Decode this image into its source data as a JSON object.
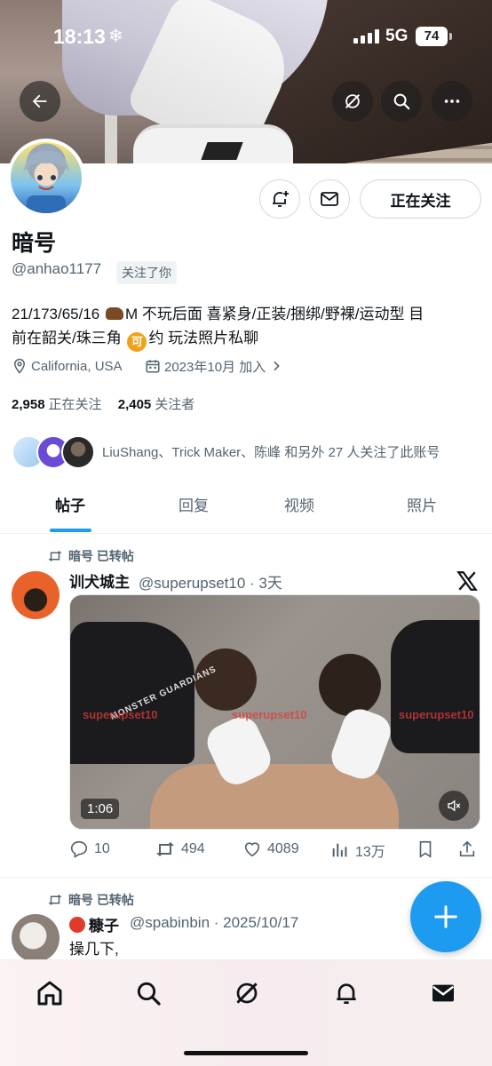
{
  "status_bar": {
    "time": "18:13",
    "network": "5G",
    "battery": "74"
  },
  "header": {
    "back_label": "back",
    "grok_label": "grok",
    "search_label": "search",
    "more_label": "more"
  },
  "profile": {
    "name": "暗号",
    "handle": "@anhao1177",
    "follows_you": "关注了你",
    "bio_line1_a": "21/173/65/16 ",
    "bio_line1_b": "M 不玩后面 喜紧身/正装/捆绑/野裸/运动型 目",
    "bio_line2_a": "前在韶关/珠三角 ",
    "bio_ke": "可",
    "bio_line2_b": "约 玩法照片私聊",
    "location": "California, USA",
    "joined": "2023年10月 加入",
    "following_count": "2,958",
    "following_label": "正在关注",
    "followers_count": "2,405",
    "followers_label": "关注者",
    "follow_button": "正在关注",
    "mutuals_text": "LiuShang、Trick Maker、陈峰 和另外 27 人关注了此账号"
  },
  "tabs": [
    "帖子",
    "回复",
    "视频",
    "照片"
  ],
  "posts": [
    {
      "retweet_label": "暗号 已转帖",
      "author_name": "训犬城主",
      "author_handle": "@superupset10 · 3天",
      "media": {
        "duration": "1:06",
        "watermark_left": "superupset10",
        "watermark_mid": "superupset10",
        "watermark_right": "superupset10",
        "shirt_text": "MONSTER GUARDIANS"
      },
      "actions": {
        "replies": "10",
        "reposts": "494",
        "likes": "4089",
        "views": "13万"
      }
    },
    {
      "retweet_label": "暗号 已转帖",
      "author_name": "糠子",
      "author_handle": "@spabinbin · 2025/10/17",
      "text_line1": "操几下,"
    }
  ],
  "colors": {
    "accent": "#1d9bf0",
    "text": "#0f1419",
    "muted": "#536471"
  },
  "icons": [
    "back-arrow-icon",
    "grok-icon",
    "search-icon",
    "more-icon",
    "notification-plus-icon",
    "mail-icon",
    "location-icon",
    "calendar-icon",
    "chevron-right-icon",
    "retweet-icon",
    "x-logo-icon",
    "reply-icon",
    "repost-icon",
    "like-icon",
    "views-icon",
    "bookmark-icon",
    "share-icon",
    "mute-icon",
    "plus-icon",
    "home-icon",
    "explore-icon",
    "grok-nav-icon",
    "bell-icon",
    "messages-icon"
  ]
}
